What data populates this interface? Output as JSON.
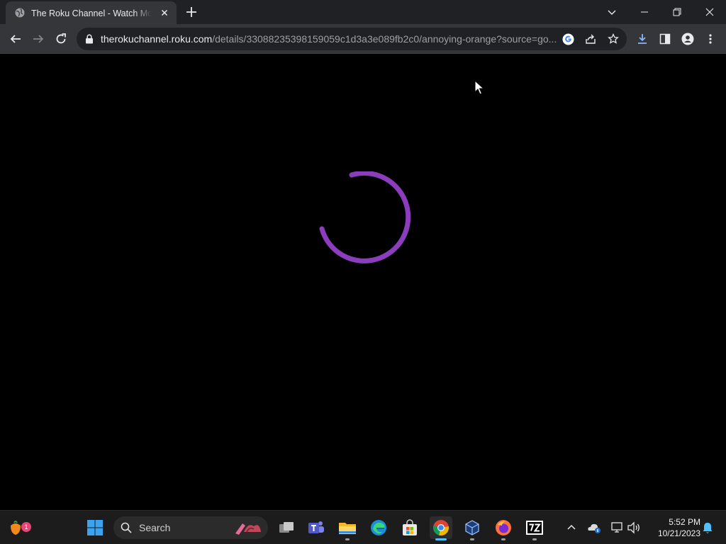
{
  "browser": {
    "tab": {
      "title": "The Roku Channel - Watch Movies & TV Shows Online For Free"
    },
    "url": {
      "host": "therokuchannel.roku.com",
      "path": "/details/33088235398159059c1d3a3e089fb2c0/annoying-orange?source=go..."
    },
    "icons": {
      "tab_favicon": "globe-icon",
      "tab_close": "close-icon",
      "new_tab": "plus-icon",
      "tab_search": "chevron-down-icon",
      "minimize": "minimize-icon",
      "restore": "restore-icon",
      "close": "close-icon",
      "back": "arrow-left-icon",
      "forward": "arrow-right-icon",
      "reload": "reload-icon",
      "lock": "lock-icon",
      "google": "google-icon",
      "share": "share-icon",
      "bookmark": "star-icon",
      "download": "download-icon",
      "side_panel": "side-panel-icon",
      "profile": "person-icon",
      "menu": "kebab-menu-icon"
    }
  },
  "page": {
    "state": "loading",
    "spinner_color": "#8b3dbd"
  },
  "taskbar": {
    "search_label": "Search",
    "widget_badge": "1",
    "apps": [
      {
        "name": "windows-start-icon"
      },
      {
        "name": "task-view-icon"
      },
      {
        "name": "teams-icon"
      },
      {
        "name": "file-explorer-icon"
      },
      {
        "name": "edge-icon"
      },
      {
        "name": "microsoft-store-icon"
      },
      {
        "name": "chrome-icon",
        "active": true
      },
      {
        "name": "virtualbox-icon"
      },
      {
        "name": "firefox-icon"
      },
      {
        "name": "7zip-icon"
      }
    ],
    "tray": [
      "chevron-up-icon",
      "onedrive-icon",
      "network-icon",
      "volume-icon"
    ],
    "time": "5:52 PM",
    "date": "10/21/2023",
    "colors": {
      "accent": "#4cc2ff",
      "bar": "#1c1c1c"
    }
  }
}
